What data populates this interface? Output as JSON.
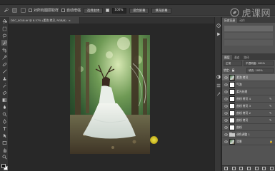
{
  "options_bar": {
    "sample_all_layers": "对所有图层取样",
    "auto_enhance": "自动增强",
    "select_subject": "选择主体",
    "refine_edge": "调整边缘...",
    "zoom": "100%",
    "fit_screen": "适合屏幕",
    "fill_screen": "填充屏幕"
  },
  "watermark": {
    "text": "虎课网"
  },
  "document_tab": {
    "title": "DSC_0018.tif @ 8.57% (柔泡 拷贝, RGB/8)"
  },
  "panels": {
    "top_tabs": [
      "历史记录",
      "动作"
    ],
    "layers_tab": "图层",
    "channels_tab": "通道",
    "paths_tab": "路径",
    "blend_mode": "正常",
    "opacity_label": "不透明度: 100%",
    "fill_label": "填充: 100%",
    "lock_label": "锁定:",
    "layers": [
      {
        "name": "柔泡 拷贝",
        "selected": true,
        "type": "image"
      },
      {
        "name": "气泡",
        "selected": false,
        "type": "white"
      },
      {
        "name": "柔光处理",
        "selected": false,
        "type": "white"
      },
      {
        "name": "曲线 拷贝 4",
        "selected": false,
        "type": "white"
      },
      {
        "name": "曲线 拷贝 3",
        "selected": false,
        "type": "white"
      },
      {
        "name": "曲线 拷贝 2",
        "selected": false,
        "type": "white"
      },
      {
        "name": "曲线 拷贝",
        "selected": false,
        "type": "white"
      },
      {
        "name": "曲线",
        "selected": false,
        "type": "white"
      },
      {
        "name": "调色调整 1",
        "selected": false,
        "type": "folder"
      },
      {
        "name": "背景",
        "selected": false,
        "type": "image"
      }
    ]
  }
}
